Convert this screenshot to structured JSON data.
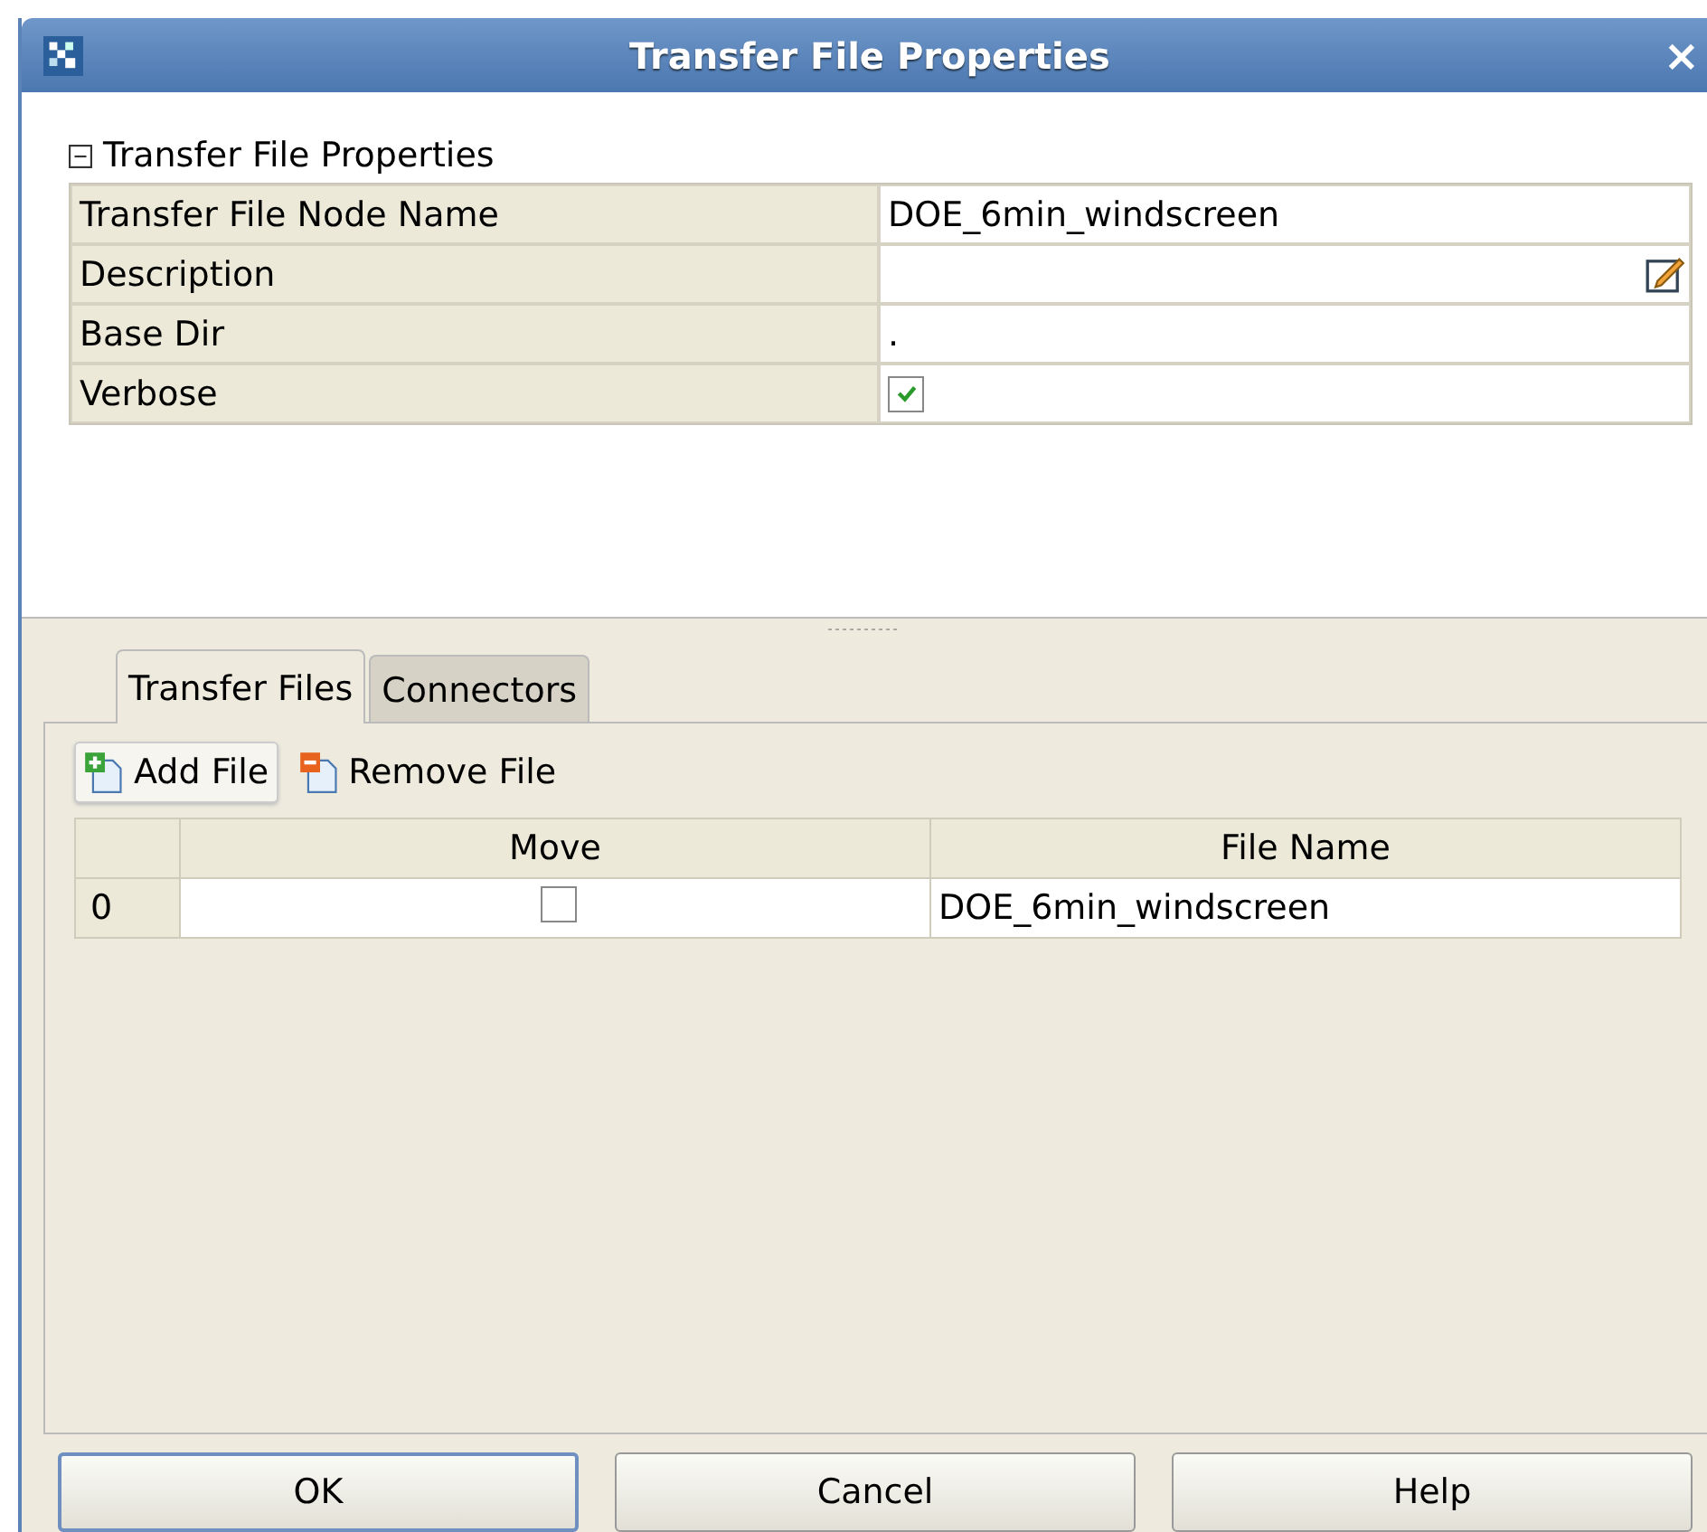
{
  "window": {
    "title": "Transfer File Properties",
    "close": "×"
  },
  "section": {
    "title": "Transfer File Properties",
    "expanded": true,
    "properties": [
      {
        "name": "Transfer File Node Name",
        "kind": "text",
        "value": "DOE_6min_windscreen"
      },
      {
        "name": "Description",
        "kind": "edit"
      },
      {
        "name": "Base Dir",
        "kind": "text",
        "value": "."
      },
      {
        "name": "Verbose",
        "kind": "checkbox",
        "checked": true
      }
    ]
  },
  "tabs": [
    {
      "label": "Transfer Files",
      "selected": true
    },
    {
      "label": "Connectors",
      "selected": false
    }
  ],
  "toolbar": [
    {
      "label": "Add File",
      "kind": "add",
      "hover": true
    },
    {
      "label": "Remove File",
      "kind": "remove",
      "hover": false
    }
  ],
  "table": {
    "columns": [
      "Move",
      "File Name"
    ],
    "rows": [
      {
        "index": "0",
        "move": false,
        "file_name": "DOE_6min_windscreen"
      }
    ]
  },
  "buttons": [
    {
      "label": "OK",
      "default": true
    },
    {
      "label": "Cancel",
      "default": false
    },
    {
      "label": "Help",
      "default": false
    }
  ]
}
